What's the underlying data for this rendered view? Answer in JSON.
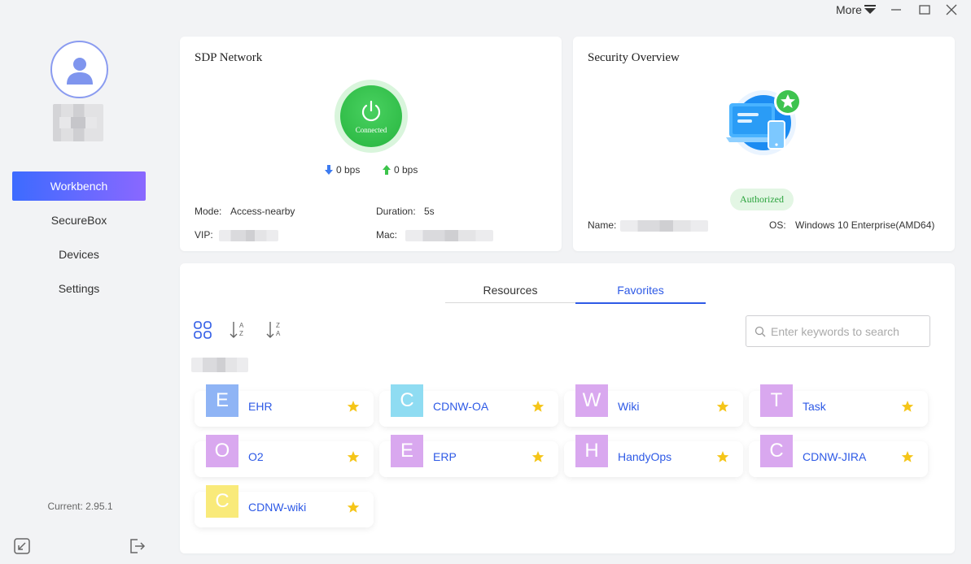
{
  "window": {
    "more_label": "More"
  },
  "sidebar": {
    "items": [
      {
        "label": "Workbench"
      },
      {
        "label": "SecureBox"
      },
      {
        "label": "Devices"
      },
      {
        "label": "Settings"
      }
    ],
    "version": "Current: 2.95.1",
    "accent_start": "#3d6bff",
    "accent_end": "#8a68ff"
  },
  "sdp": {
    "title": "SDP Network",
    "status": "Connected",
    "download": "0 bps",
    "upload": "0 bps",
    "mode_label": "Mode:",
    "mode_value": "Access-nearby",
    "duration_label": "Duration:",
    "duration_value": "5s",
    "vip_label": "VIP:",
    "mac_label": "Mac:",
    "status_color": "#27b53f"
  },
  "security": {
    "title": "Security Overview",
    "badge": "Authorized",
    "name_label": "Name:",
    "os_label": "OS:",
    "os_value": "Windows 10 Enterprise(AMD64)"
  },
  "resources": {
    "tabs": [
      {
        "label": "Resources",
        "active": false
      },
      {
        "label": "Favorites",
        "active": true
      }
    ],
    "search_placeholder": "Enter keywords to search",
    "tiles": [
      {
        "letter": "E",
        "name": "EHR",
        "color": "#8fb4f5",
        "starred": true
      },
      {
        "letter": "C",
        "name": "CDNW-OA",
        "color": "#8fdcf2",
        "starred": true
      },
      {
        "letter": "W",
        "name": "Wiki",
        "color": "#d9a8ef",
        "starred": true
      },
      {
        "letter": "T",
        "name": "Task",
        "color": "#d9a8ef",
        "starred": true
      },
      {
        "letter": "O",
        "name": "O2",
        "color": "#d9a8ef",
        "starred": true
      },
      {
        "letter": "E",
        "name": "ERP",
        "color": "#d9a8ef",
        "starred": true
      },
      {
        "letter": "H",
        "name": "HandyOps",
        "color": "#d9a8ef",
        "starred": true
      },
      {
        "letter": "C",
        "name": "CDNW-JIRA",
        "color": "#d9a8ef",
        "starred": true
      },
      {
        "letter": "C",
        "name": "CDNW-wiki",
        "color": "#f9ea7a",
        "starred": true
      }
    ]
  }
}
